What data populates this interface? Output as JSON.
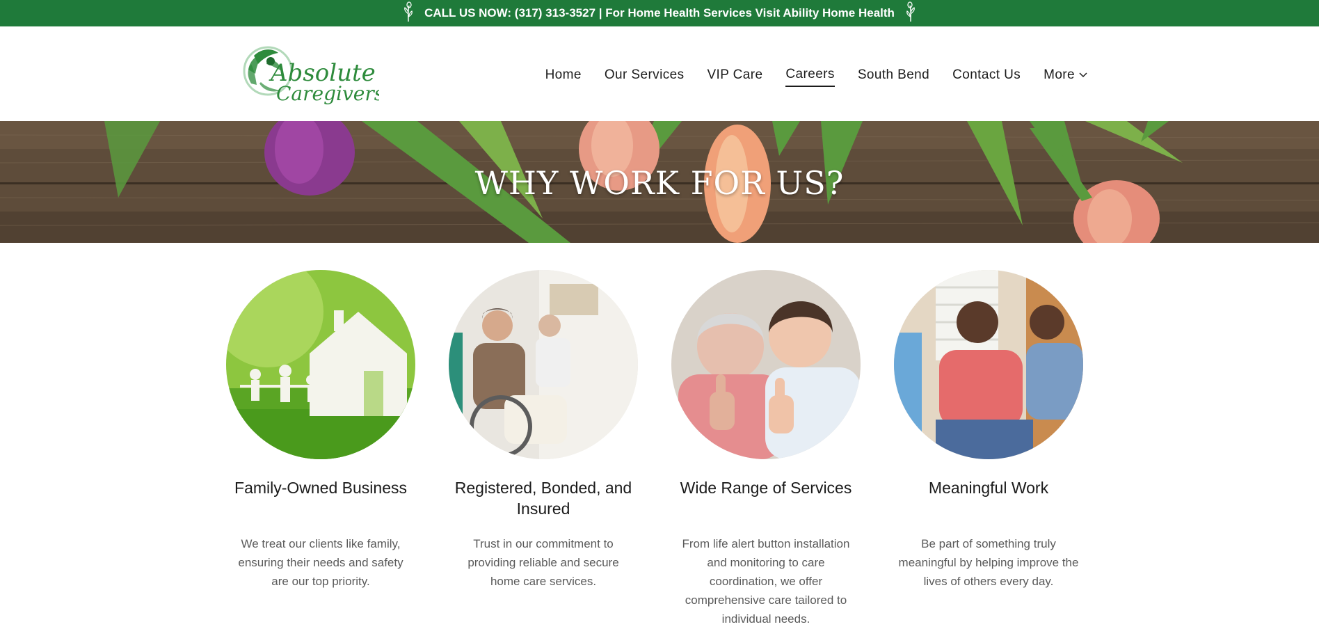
{
  "topbar": {
    "text": "CALL US NOW: (317) 313-3527 | For Home Health Services Visit Ability Home Health",
    "icon": "flower-sprig-icon",
    "background": "#1f7a3a"
  },
  "logo": {
    "line1": "Absolute",
    "line2": "Caregivers",
    "color": "#2e8b3c"
  },
  "nav": {
    "items": [
      {
        "label": "Home"
      },
      {
        "label": "Our Services"
      },
      {
        "label": "VIP Care"
      },
      {
        "label": "Careers",
        "active": true
      },
      {
        "label": "South Bend"
      },
      {
        "label": "Contact Us"
      },
      {
        "label": "More",
        "icon": "chevron-down-icon"
      }
    ]
  },
  "hero": {
    "title": "WHY WORK FOR US?"
  },
  "features": [
    {
      "title": "Family-Owned Business",
      "text": "We treat our clients like family, ensuring their needs and safety are our top priority."
    },
    {
      "title": "Registered, Bonded, and Insured",
      "text": "Trust in our commitment to providing reliable and secure home care services."
    },
    {
      "title": "Wide Range of Services",
      "text": "From life alert button installation and monitoring to care coordination, we offer comprehensive care tailored to individual needs."
    },
    {
      "title": "Meaningful Work",
      "text": "Be part of something truly meaningful by helping improve the lives of others every day."
    }
  ]
}
